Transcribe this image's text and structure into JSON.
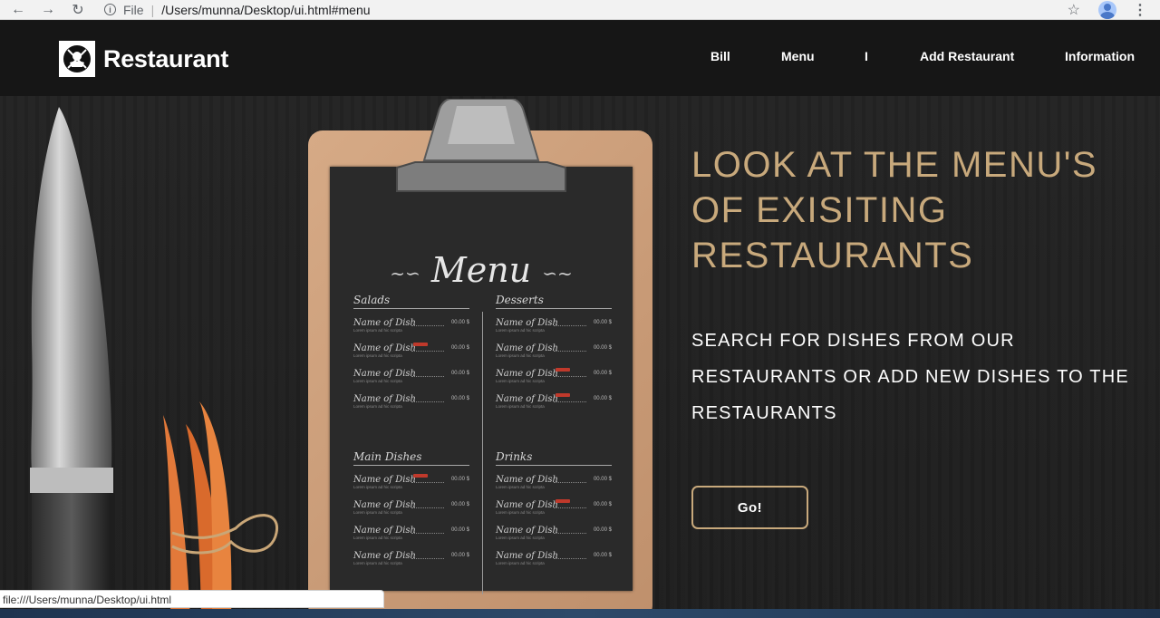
{
  "browser": {
    "back_icon": "←",
    "forward_icon": "→",
    "reload_icon": "↻",
    "scheme_label": "File",
    "url": "/Users/munna/Desktop/ui.html#menu",
    "star_icon": "☆",
    "kebab_icon": "⋮"
  },
  "header": {
    "brand": "Restaurant",
    "nav": [
      "Bill",
      "Menu",
      "I",
      "Add Restaurant",
      "Information"
    ]
  },
  "menu_board": {
    "title": "Menu",
    "sections": [
      {
        "title": "Salads",
        "dishes": [
          {
            "name": "Name of Dish",
            "price": "00.00 $",
            "desc": "Lorem ipsum ad hic scripta",
            "badge": false
          },
          {
            "name": "Name of Dish",
            "price": "00.00 $",
            "desc": "Lorem ipsum ad hic scripta",
            "badge": true
          },
          {
            "name": "Name of Dish",
            "price": "00.00 $",
            "desc": "Lorem ipsum ad hic scripta",
            "badge": false
          },
          {
            "name": "Name of Dish",
            "price": "00.00 $",
            "desc": "Lorem ipsum ad hic scripta",
            "badge": false
          }
        ]
      },
      {
        "title": "Desserts",
        "dishes": [
          {
            "name": "Name of Dish",
            "price": "00.00 $",
            "desc": "Lorem ipsum ad hic scripta",
            "badge": false
          },
          {
            "name": "Name of Dish",
            "price": "00.00 $",
            "desc": "Lorem ipsum ad hic scripta",
            "badge": false
          },
          {
            "name": "Name of Dish",
            "price": "00.00 $",
            "desc": "Lorem ipsum ad hic scripta",
            "badge": true
          },
          {
            "name": "Name of Dish",
            "price": "00.00 $",
            "desc": "Lorem ipsum ad hic scripta",
            "badge": true
          }
        ]
      },
      {
        "title": "Main Dishes",
        "dishes": [
          {
            "name": "Name of Dish",
            "price": "00.00 $",
            "desc": "Lorem ipsum ad hic scripta",
            "badge": true
          },
          {
            "name": "Name of Dish",
            "price": "00.00 $",
            "desc": "Lorem ipsum ad hic scripta",
            "badge": false
          },
          {
            "name": "Name of Dish",
            "price": "00.00 $",
            "desc": "Lorem ipsum ad hic scripta",
            "badge": false
          },
          {
            "name": "Name of Dish",
            "price": "00.00 $",
            "desc": "Lorem ipsum ad hic scripta",
            "badge": false
          }
        ]
      },
      {
        "title": "Drinks",
        "dishes": [
          {
            "name": "Name of Dish",
            "price": "00.00 $",
            "desc": "Lorem ipsum ad hic scripta",
            "badge": false
          },
          {
            "name": "Name of Dish",
            "price": "00.00 $",
            "desc": "Lorem ipsum ad hic scripta",
            "badge": true
          },
          {
            "name": "Name of Dish",
            "price": "00.00 $",
            "desc": "Lorem ipsum ad hic scripta",
            "badge": false
          },
          {
            "name": "Name of Dish",
            "price": "00.00 $",
            "desc": "Lorem ipsum ad hic scripta",
            "badge": false
          }
        ]
      }
    ]
  },
  "hero": {
    "title": "LOOK AT THE MENU'S OF EXISITING RESTAURANTS",
    "subtitle": "SEARCH FOR DISHES FROM OUR RESTAURANTS OR ADD NEW DISHES TO THE RESTAURANTS",
    "button": "Go!"
  },
  "status_bar": "file:///Users/munna/Desktop/ui.html",
  "colors": {
    "accent": "#c8a97c",
    "background": "#1e1e1e",
    "navbar": "#141414"
  }
}
